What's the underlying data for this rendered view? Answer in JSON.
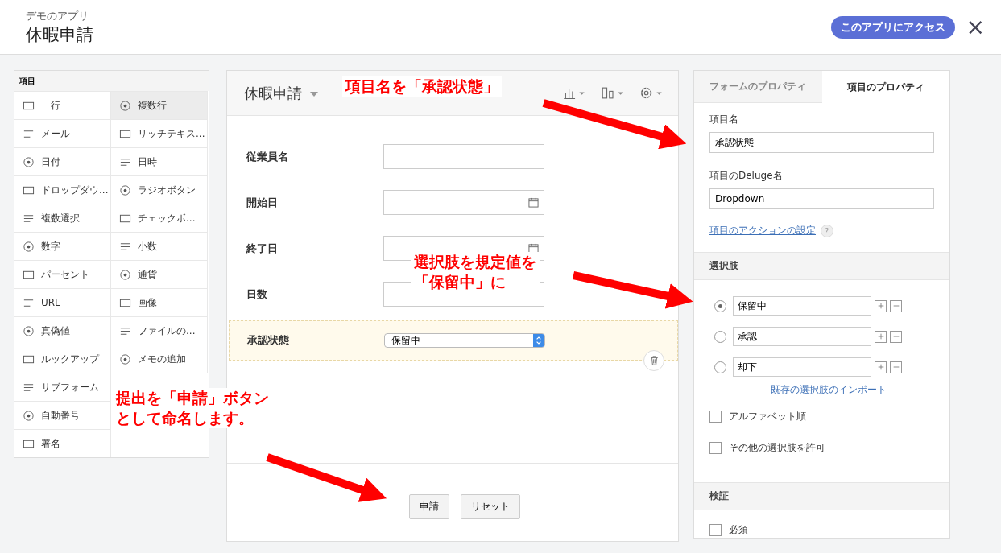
{
  "header": {
    "app_name": "デモのアプリ",
    "form_title": "休暇申請",
    "access_button": "このアプリにアクセス",
    "close": "×"
  },
  "field_palette": {
    "title": "項目",
    "columns": [
      [
        {
          "label": "一行",
          "selected": false
        },
        {
          "label": "メール",
          "selected": false
        },
        {
          "label": "日付",
          "selected": false
        },
        {
          "label": "ドロップダウ...",
          "selected": false
        },
        {
          "label": "複数選択",
          "selected": false
        },
        {
          "label": "数字",
          "selected": false
        },
        {
          "label": "パーセント",
          "selected": false
        },
        {
          "label": "URL",
          "selected": false
        },
        {
          "label": "真偽値",
          "selected": false
        },
        {
          "label": "ルックアップ",
          "selected": false
        },
        {
          "label": "サブフォーム",
          "selected": false
        },
        {
          "label": "自動番号",
          "selected": false
        },
        {
          "label": "署名",
          "selected": false
        }
      ],
      [
        {
          "label": "複数行",
          "selected": true
        },
        {
          "label": "リッチテキス...",
          "selected": false
        },
        {
          "label": "日時",
          "selected": false
        },
        {
          "label": "ラジオボタン",
          "selected": false
        },
        {
          "label": "チェックボ...",
          "selected": false
        },
        {
          "label": "小数",
          "selected": false
        },
        {
          "label": "通貨",
          "selected": false
        },
        {
          "label": "画像",
          "selected": false
        },
        {
          "label": "ファイルの...",
          "selected": false
        },
        {
          "label": "メモの追加",
          "selected": false
        },
        {
          "kind": "covered",
          "selected": false
        }
      ]
    ]
  },
  "form": {
    "title": "休暇申請",
    "fields": [
      {
        "label": "従業員名",
        "kind": "text",
        "selected": false
      },
      {
        "label": "開始日",
        "kind": "date",
        "selected": false
      },
      {
        "label": "終了日",
        "kind": "date",
        "selected": false
      },
      {
        "label": "日数",
        "kind": "text",
        "selected": false
      },
      {
        "label": "承認状態",
        "kind": "dropdown",
        "value": "保留中",
        "selected": true
      }
    ],
    "buttons": [
      "申請",
      "リセット"
    ]
  },
  "properties": {
    "tabs": [
      {
        "label": "フォームのプロパティ",
        "selected": false
      },
      {
        "label": "項目のプロパティ",
        "selected": true
      }
    ],
    "field_name_label": "項目名",
    "field_name": "承認状態",
    "deluge_label": "項目のDeluge名",
    "deluge_name": "Dropdown",
    "action_link": "項目のアクションの設定",
    "help": "?",
    "choices_title": "選択肢",
    "choices": [
      {
        "value": "保留中",
        "selected": true
      },
      {
        "value": "承認",
        "selected": false
      },
      {
        "value": "却下",
        "selected": false
      }
    ],
    "import_link": "既存の選択肢のインポート",
    "options": [
      {
        "label": "アルファベット順",
        "checked": false
      },
      {
        "label": "その他の選択肢を許可",
        "checked": false
      }
    ],
    "validation_title": "検証",
    "validation": [
      {
        "label": "必須",
        "checked": false
      }
    ]
  },
  "annotations": [
    {
      "lines": [
        "項目名を「承認状態」"
      ]
    },
    {
      "lines": [
        "選択肢を規定値を",
        "「保留中」に"
      ]
    },
    {
      "lines": [
        "提出を「申請」ボタン",
        "として命名します。"
      ]
    }
  ]
}
